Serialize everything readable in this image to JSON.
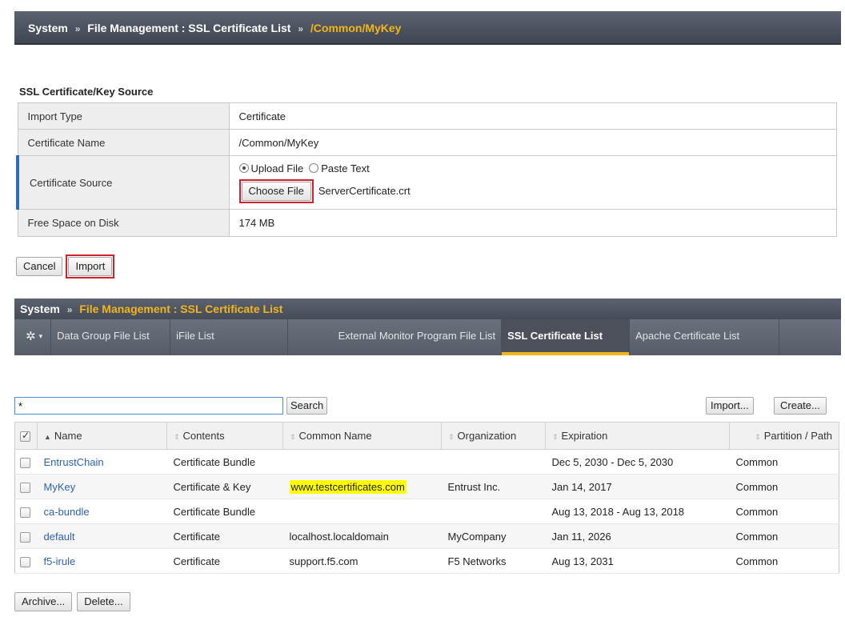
{
  "top_panel": {
    "breadcrumb": {
      "root": "System",
      "separator": "»",
      "section": "File Management : SSL Certificate List",
      "current": "/Common/MyKey"
    },
    "section_title": "SSL Certificate/Key Source",
    "properties": {
      "import_type_label": "Import Type",
      "import_type_value": "Certificate",
      "cert_name_label": "Certificate Name",
      "cert_name_value": "/Common/MyKey",
      "cert_source_label": "Certificate Source",
      "upload_file_label": "Upload File",
      "paste_text_label": "Paste Text",
      "selected_source": "Upload File",
      "choose_file_label": "Choose File",
      "chosen_file_name": "ServerCertificate.crt",
      "free_space_label": "Free Space on Disk",
      "free_space_value": "174 MB"
    },
    "cancel_label": "Cancel",
    "import_label": "Import"
  },
  "bottom_panel": {
    "breadcrumb": {
      "root": "System",
      "separator": "»",
      "current": "File Management : SSL Certificate List"
    },
    "tabs": [
      {
        "label": "Data Group File List",
        "active": false
      },
      {
        "label": "iFile List",
        "active": false
      },
      {
        "label": "External Monitor Program File List",
        "active": false
      },
      {
        "label": "SSL Certificate List",
        "active": true
      },
      {
        "label": "Apache Certificate List",
        "active": false
      }
    ],
    "gear_icon": "gear-icon",
    "search": {
      "value": "*",
      "button_label": "Search"
    },
    "import_label": "Import...",
    "create_label": "Create...",
    "columns": {
      "name": "Name",
      "contents": "Contents",
      "common_name": "Common Name",
      "organization": "Organization",
      "expiration": "Expiration",
      "partition": "Partition / Path"
    },
    "rows": [
      {
        "name": "EntrustChain",
        "contents": "Certificate Bundle",
        "common_name": "",
        "organization": "",
        "expiration": "Dec 5, 2030 - Dec 5, 2030",
        "partition": "Common"
      },
      {
        "name": "MyKey",
        "contents": "Certificate & Key",
        "common_name": "www.testcertificates.com",
        "organization": "Entrust Inc.",
        "expiration": "Jan 14, 2017",
        "partition": "Common"
      },
      {
        "name": "ca-bundle",
        "contents": "Certificate Bundle",
        "common_name": "",
        "organization": "",
        "expiration": "Aug 13, 2018 - Aug 13, 2018",
        "partition": "Common"
      },
      {
        "name": "default",
        "contents": "Certificate",
        "common_name": "localhost.localdomain",
        "organization": "MyCompany",
        "expiration": "Jan 11, 2026",
        "partition": "Common"
      },
      {
        "name": "f5-irule",
        "contents": "Certificate",
        "common_name": "support.f5.com",
        "organization": "F5 Networks",
        "expiration": "Aug 13, 2031",
        "partition": "Common"
      }
    ],
    "archive_label": "Archive...",
    "delete_label": "Delete...",
    "colors": {
      "accent": "#f2b51b",
      "link": "#2d62b5",
      "highlight": "#ffff00",
      "callout": "#d0222a"
    }
  }
}
